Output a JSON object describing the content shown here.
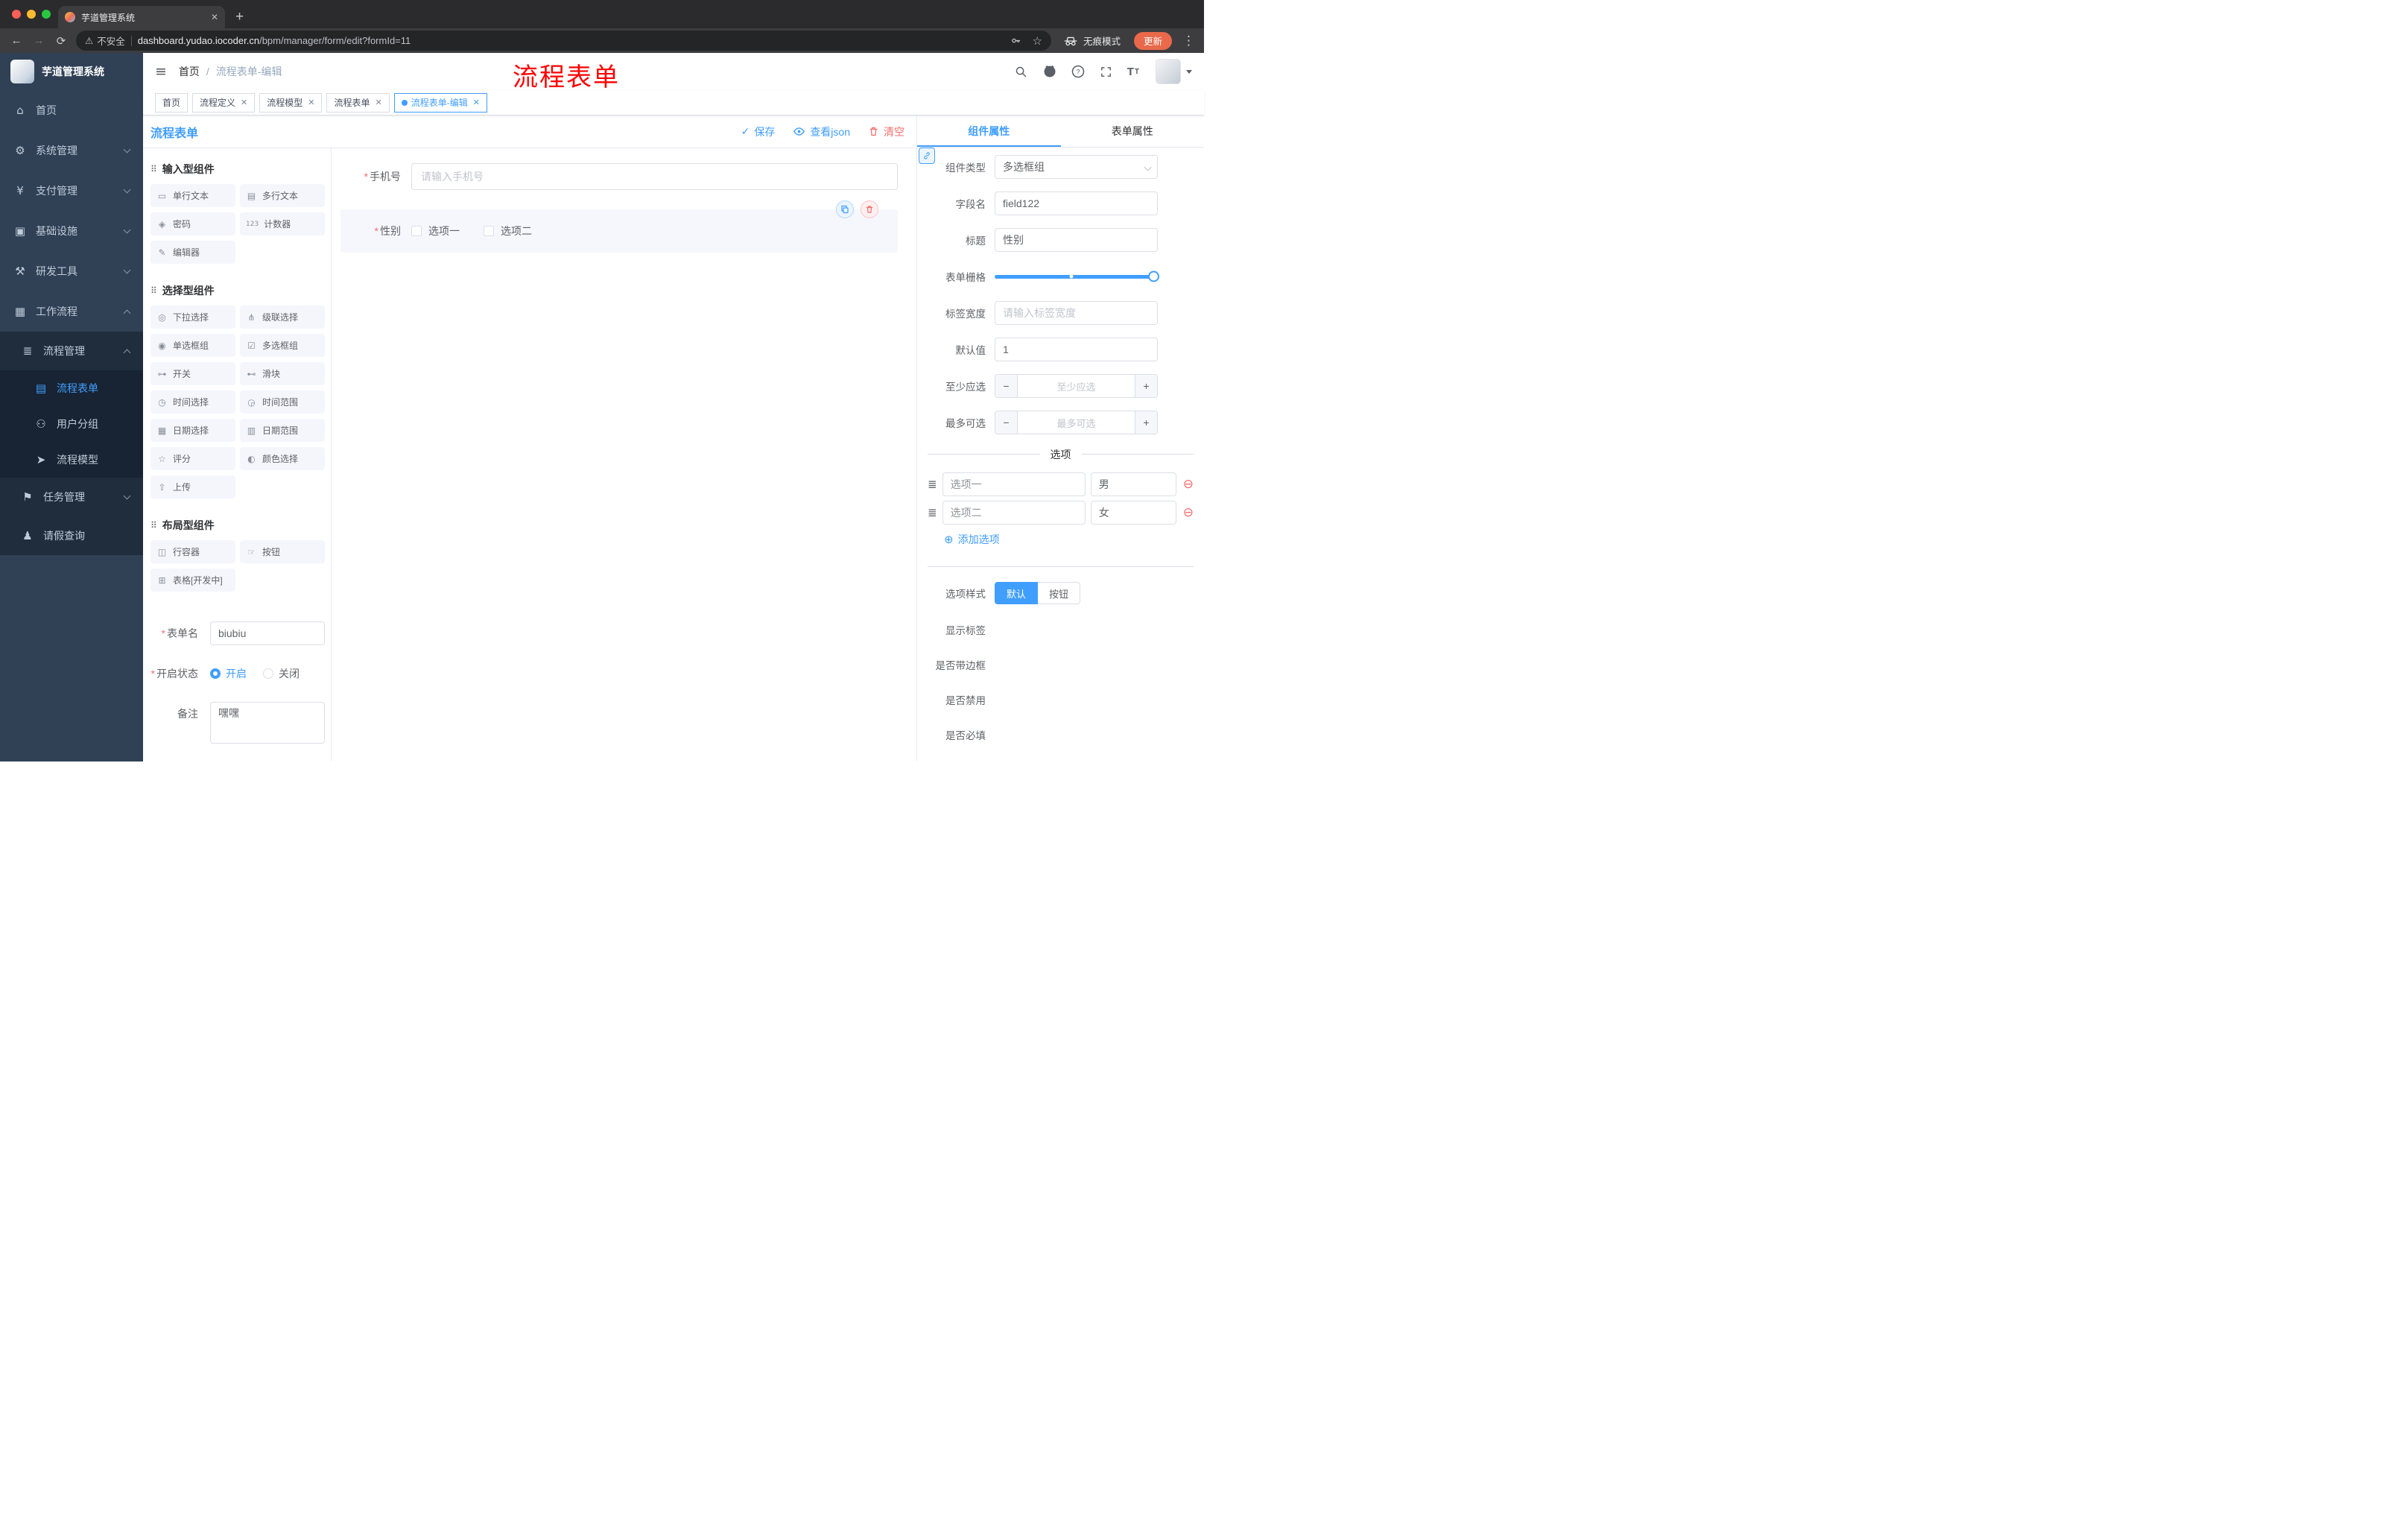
{
  "icons": {
    "close": "✕",
    "new_tab": "+",
    "back": "←",
    "forward": "→",
    "reload": "⟳",
    "warning": "⚠",
    "menu_dots": "⋮",
    "hamburger": "≡",
    "breadcrumb_sep": "/",
    "check": "✓",
    "section_drag": "⠿",
    "minus": "−",
    "plus": "+",
    "remove_circle": "⊖",
    "add_circle": "⊕",
    "tune": "≣",
    "question": "?",
    "font_size_big": "T",
    "font_size_small": "T",
    "star": "☆",
    "asterisk": "*"
  },
  "colors": {
    "accent": "#409eff",
    "danger": "#f56c6c",
    "sidebar_bg": "#304156",
    "submenu_bg": "#1f2d3d"
  },
  "annotation": {
    "text": "流程表单"
  },
  "browser": {
    "tab_title": "芋道管理系统",
    "security_label": "不安全",
    "url_host": "dashboard.yudao.iocoder.cn",
    "url_path": "/bpm/manager/form/edit?formId=11",
    "incognito_label": "无痕模式",
    "update_label": "更新"
  },
  "sidebar": {
    "logo_title": "芋道管理系统",
    "menu": [
      {
        "label": "首页",
        "glyph": "⌂"
      },
      {
        "label": "系统管理",
        "glyph": "⚙"
      },
      {
        "label": "支付管理",
        "glyph": "¥"
      },
      {
        "label": "基础设施",
        "glyph": "▣"
      },
      {
        "label": "研发工具",
        "glyph": "⚒"
      },
      {
        "label": "工作流程",
        "glyph": "▦"
      }
    ],
    "submenu": {
      "process_mgmt": {
        "label": "流程管理",
        "glyph": "≣"
      },
      "children": [
        {
          "label": "流程表单",
          "glyph": "▤"
        },
        {
          "label": "用户分组",
          "glyph": "⚇"
        },
        {
          "label": "流程模型",
          "glyph": "➤"
        }
      ],
      "task_mgmt": {
        "label": "任务管理",
        "glyph": "⚑"
      },
      "leave_query": {
        "label": "请假查询",
        "glyph": "♟"
      }
    }
  },
  "navbar": {
    "breadcrumb": [
      "首页",
      "流程表单-编辑"
    ]
  },
  "tags": [
    {
      "label": "首页",
      "closable": false,
      "active": false
    },
    {
      "label": "流程定义",
      "closable": true,
      "active": false
    },
    {
      "label": "流程模型",
      "closable": true,
      "active": false
    },
    {
      "label": "流程表单",
      "closable": true,
      "active": false
    },
    {
      "label": "流程表单-编辑",
      "closable": true,
      "active": true
    }
  ],
  "toolbar": {
    "title": "流程表单",
    "save": "保存",
    "view_json": "查看json",
    "clear": "清空"
  },
  "palette": {
    "sections": [
      {
        "title": "输入型组件",
        "items": [
          {
            "label": "单行文本",
            "glyph": "▭"
          },
          {
            "label": "多行文本",
            "glyph": "▤"
          },
          {
            "label": "密码",
            "glyph": "◈"
          },
          {
            "label": "计数器",
            "glyph": "123"
          },
          {
            "label": "编辑器",
            "glyph": "✎"
          }
        ]
      },
      {
        "title": "选择型组件",
        "items": [
          {
            "label": "下拉选择",
            "glyph": "◎"
          },
          {
            "label": "级联选择",
            "glyph": "⋔"
          },
          {
            "label": "单选框组",
            "glyph": "◉"
          },
          {
            "label": "多选框组",
            "glyph": "☑"
          },
          {
            "label": "开关",
            "glyph": "⊶"
          },
          {
            "label": "滑块",
            "glyph": "⊷"
          },
          {
            "label": "时间选择",
            "glyph": "◷"
          },
          {
            "label": "时间范围",
            "glyph": "◶"
          },
          {
            "label": "日期选择",
            "glyph": "▦"
          },
          {
            "label": "日期范围",
            "glyph": "▥"
          },
          {
            "label": "评分",
            "glyph": "☆"
          },
          {
            "label": "颜色选择",
            "glyph": "◐"
          },
          {
            "label": "上传",
            "glyph": "⇧"
          }
        ]
      },
      {
        "title": "布局型组件",
        "items": [
          {
            "label": "行容器",
            "glyph": "◫"
          },
          {
            "label": "按钮",
            "glyph": "☞"
          },
          {
            "label": "表格[开发中]",
            "glyph": "⊞"
          }
        ]
      }
    ],
    "form": {
      "name_label": "表单名",
      "name_value": "biubiu",
      "status_label": "开启状态",
      "status_on": "开启",
      "status_off": "关闭",
      "remark_label": "备注",
      "remark_value": "嘿嘿"
    }
  },
  "canvas": {
    "phone": {
      "label": "手机号",
      "placeholder": "请输入手机号",
      "required": true
    },
    "gender": {
      "label": "性别",
      "required": true,
      "options": [
        "选项一",
        "选项二"
      ],
      "selected": true
    }
  },
  "props": {
    "tabs": [
      "组件属性",
      "表单属性"
    ],
    "component_type": {
      "label": "组件类型",
      "value": "多选框组"
    },
    "field_name": {
      "label": "字段名",
      "value": "field122"
    },
    "title": {
      "label": "标题",
      "value": "性别"
    },
    "form_grid": {
      "label": "表单栅格"
    },
    "label_width": {
      "label": "标签宽度",
      "placeholder": "请输入标签宽度"
    },
    "default_value": {
      "label": "默认值",
      "value": "1"
    },
    "min_select": {
      "label": "至少应选",
      "placeholder": "至少应选"
    },
    "max_select": {
      "label": "最多可选",
      "placeholder": "最多可选"
    },
    "options_title": "选项",
    "options": [
      {
        "label": "选项一",
        "value": "男"
      },
      {
        "label": "选项二",
        "value": "女"
      }
    ],
    "add_option": "添加选项",
    "option_style": {
      "label": "选项样式",
      "default": "默认",
      "button": "按钮",
      "selected": "默认"
    },
    "show_label": {
      "label": "显示标签",
      "on": true
    },
    "with_border": {
      "label": "是否带边框",
      "on": false
    },
    "disabled": {
      "label": "是否禁用",
      "on": false
    },
    "required": {
      "label": "是否必填",
      "on": true
    }
  }
}
